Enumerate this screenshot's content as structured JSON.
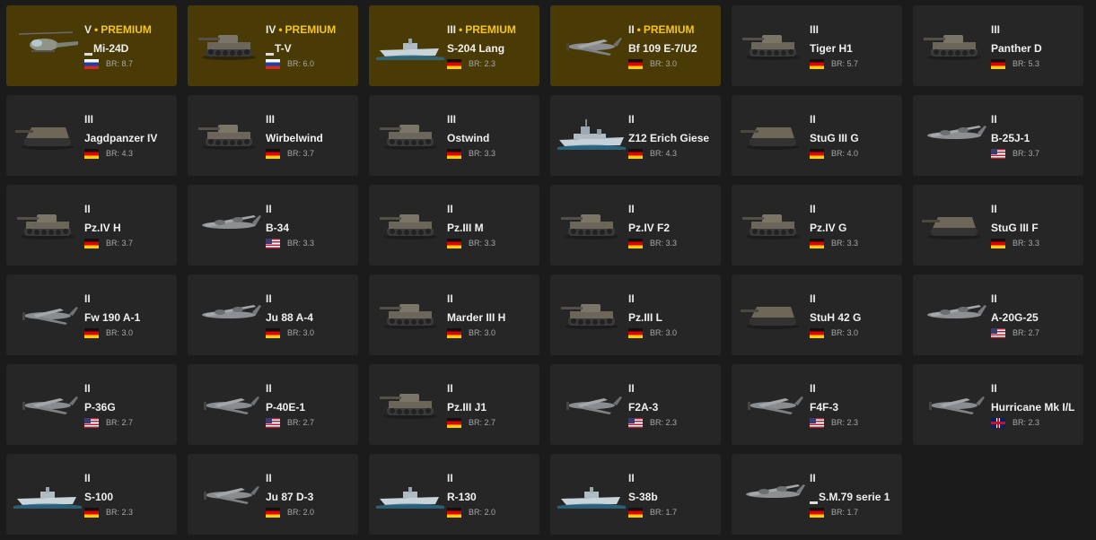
{
  "palette": {
    "card_bg": "#262626",
    "premium_bg": "#4a3b06",
    "premium_text": "#f5c518",
    "page_bg": "#1b1b1b"
  },
  "vehicles": [
    {
      "tier": "V",
      "premium": true,
      "premium_label": "PREMIUM",
      "name": "Mi-24D",
      "mark": true,
      "country": "ru",
      "br": "BR: 8.7",
      "kind": "heli"
    },
    {
      "tier": "IV",
      "premium": true,
      "premium_label": "PREMIUM",
      "name": "T-V",
      "mark": true,
      "country": "ru",
      "br": "BR: 6.0",
      "kind": "tank"
    },
    {
      "tier": "III",
      "premium": true,
      "premium_label": "PREMIUM",
      "name": "S-204 Lang",
      "mark": false,
      "country": "de",
      "br": "BR: 2.3",
      "kind": "boat"
    },
    {
      "tier": "II",
      "premium": true,
      "premium_label": "PREMIUM",
      "name": "Bf 109 E-7/U2",
      "mark": false,
      "country": "de",
      "br": "BR: 3.0",
      "kind": "plane"
    },
    {
      "tier": "III",
      "premium": false,
      "name": "Tiger H1",
      "mark": false,
      "country": "de",
      "br": "BR: 5.7",
      "kind": "tank"
    },
    {
      "tier": "III",
      "premium": false,
      "name": "Panther D",
      "mark": false,
      "country": "de",
      "br": "BR: 5.3",
      "kind": "tank"
    },
    {
      "tier": "III",
      "premium": false,
      "name": "Jagdpanzer IV",
      "mark": false,
      "country": "de",
      "br": "BR: 4.3",
      "kind": "td"
    },
    {
      "tier": "III",
      "premium": false,
      "name": "Wirbelwind",
      "mark": false,
      "country": "de",
      "br": "BR: 3.7",
      "kind": "tank"
    },
    {
      "tier": "III",
      "premium": false,
      "name": "Ostwind",
      "mark": false,
      "country": "de",
      "br": "BR: 3.3",
      "kind": "tank"
    },
    {
      "tier": "II",
      "premium": false,
      "name": "Z12 Erich Giese",
      "mark": false,
      "country": "de",
      "br": "BR: 4.3",
      "kind": "ship"
    },
    {
      "tier": "II",
      "premium": false,
      "name": "StuG III G",
      "mark": false,
      "country": "de",
      "br": "BR: 4.0",
      "kind": "td"
    },
    {
      "tier": "II",
      "premium": false,
      "name": "B-25J-1",
      "mark": false,
      "country": "us",
      "br": "BR: 3.7",
      "kind": "bomber"
    },
    {
      "tier": "II",
      "premium": false,
      "name": "Pz.IV H",
      "mark": false,
      "country": "de",
      "br": "BR: 3.7",
      "kind": "tank"
    },
    {
      "tier": "II",
      "premium": false,
      "name": "B-34",
      "mark": false,
      "country": "us",
      "br": "BR: 3.3",
      "kind": "bomber"
    },
    {
      "tier": "II",
      "premium": false,
      "name": "Pz.III M",
      "mark": false,
      "country": "de",
      "br": "BR: 3.3",
      "kind": "tank"
    },
    {
      "tier": "II",
      "premium": false,
      "name": "Pz.IV F2",
      "mark": false,
      "country": "de",
      "br": "BR: 3.3",
      "kind": "tank"
    },
    {
      "tier": "II",
      "premium": false,
      "name": "Pz.IV G",
      "mark": false,
      "country": "de",
      "br": "BR: 3.3",
      "kind": "tank"
    },
    {
      "tier": "II",
      "premium": false,
      "name": "StuG III F",
      "mark": false,
      "country": "de",
      "br": "BR: 3.3",
      "kind": "td"
    },
    {
      "tier": "II",
      "premium": false,
      "name": "Fw 190 A-1",
      "mark": false,
      "country": "de",
      "br": "BR: 3.0",
      "kind": "plane"
    },
    {
      "tier": "II",
      "premium": false,
      "name": "Ju 88 A-4",
      "mark": false,
      "country": "de",
      "br": "BR: 3.0",
      "kind": "bomber"
    },
    {
      "tier": "II",
      "premium": false,
      "name": "Marder III H",
      "mark": false,
      "country": "de",
      "br": "BR: 3.0",
      "kind": "tank"
    },
    {
      "tier": "II",
      "premium": false,
      "name": "Pz.III L",
      "mark": false,
      "country": "de",
      "br": "BR: 3.0",
      "kind": "tank"
    },
    {
      "tier": "II",
      "premium": false,
      "name": "StuH 42 G",
      "mark": false,
      "country": "de",
      "br": "BR: 3.0",
      "kind": "td"
    },
    {
      "tier": "II",
      "premium": false,
      "name": "A-20G-25",
      "mark": false,
      "country": "us",
      "br": "BR: 2.7",
      "kind": "bomber"
    },
    {
      "tier": "II",
      "premium": false,
      "name": "P-36G",
      "mark": false,
      "country": "us",
      "br": "BR: 2.7",
      "kind": "plane"
    },
    {
      "tier": "II",
      "premium": false,
      "name": "P-40E-1",
      "mark": false,
      "country": "us",
      "br": "BR: 2.7",
      "kind": "plane"
    },
    {
      "tier": "II",
      "premium": false,
      "name": "Pz.III J1",
      "mark": false,
      "country": "de",
      "br": "BR: 2.7",
      "kind": "tank"
    },
    {
      "tier": "II",
      "premium": false,
      "name": "F2A-3",
      "mark": false,
      "country": "us",
      "br": "BR: 2.3",
      "kind": "plane"
    },
    {
      "tier": "II",
      "premium": false,
      "name": "F4F-3",
      "mark": false,
      "country": "us",
      "br": "BR: 2.3",
      "kind": "plane"
    },
    {
      "tier": "II",
      "premium": false,
      "name": "Hurricane Mk I/L",
      "mark": false,
      "country": "uk",
      "br": "BR: 2.3",
      "kind": "plane"
    },
    {
      "tier": "II",
      "premium": false,
      "name": "S-100",
      "mark": false,
      "country": "de",
      "br": "BR: 2.3",
      "kind": "boat"
    },
    {
      "tier": "II",
      "premium": false,
      "name": "Ju 87 D-3",
      "mark": false,
      "country": "de",
      "br": "BR: 2.0",
      "kind": "plane"
    },
    {
      "tier": "II",
      "premium": false,
      "name": "R-130",
      "mark": false,
      "country": "de",
      "br": "BR: 2.0",
      "kind": "boat"
    },
    {
      "tier": "II",
      "premium": false,
      "name": "S-38b",
      "mark": false,
      "country": "de",
      "br": "BR: 1.7",
      "kind": "boat"
    },
    {
      "tier": "II",
      "premium": false,
      "name": "S.M.79 serie 1",
      "mark": true,
      "country": "de",
      "br": "BR: 1.7",
      "kind": "bomber"
    }
  ]
}
